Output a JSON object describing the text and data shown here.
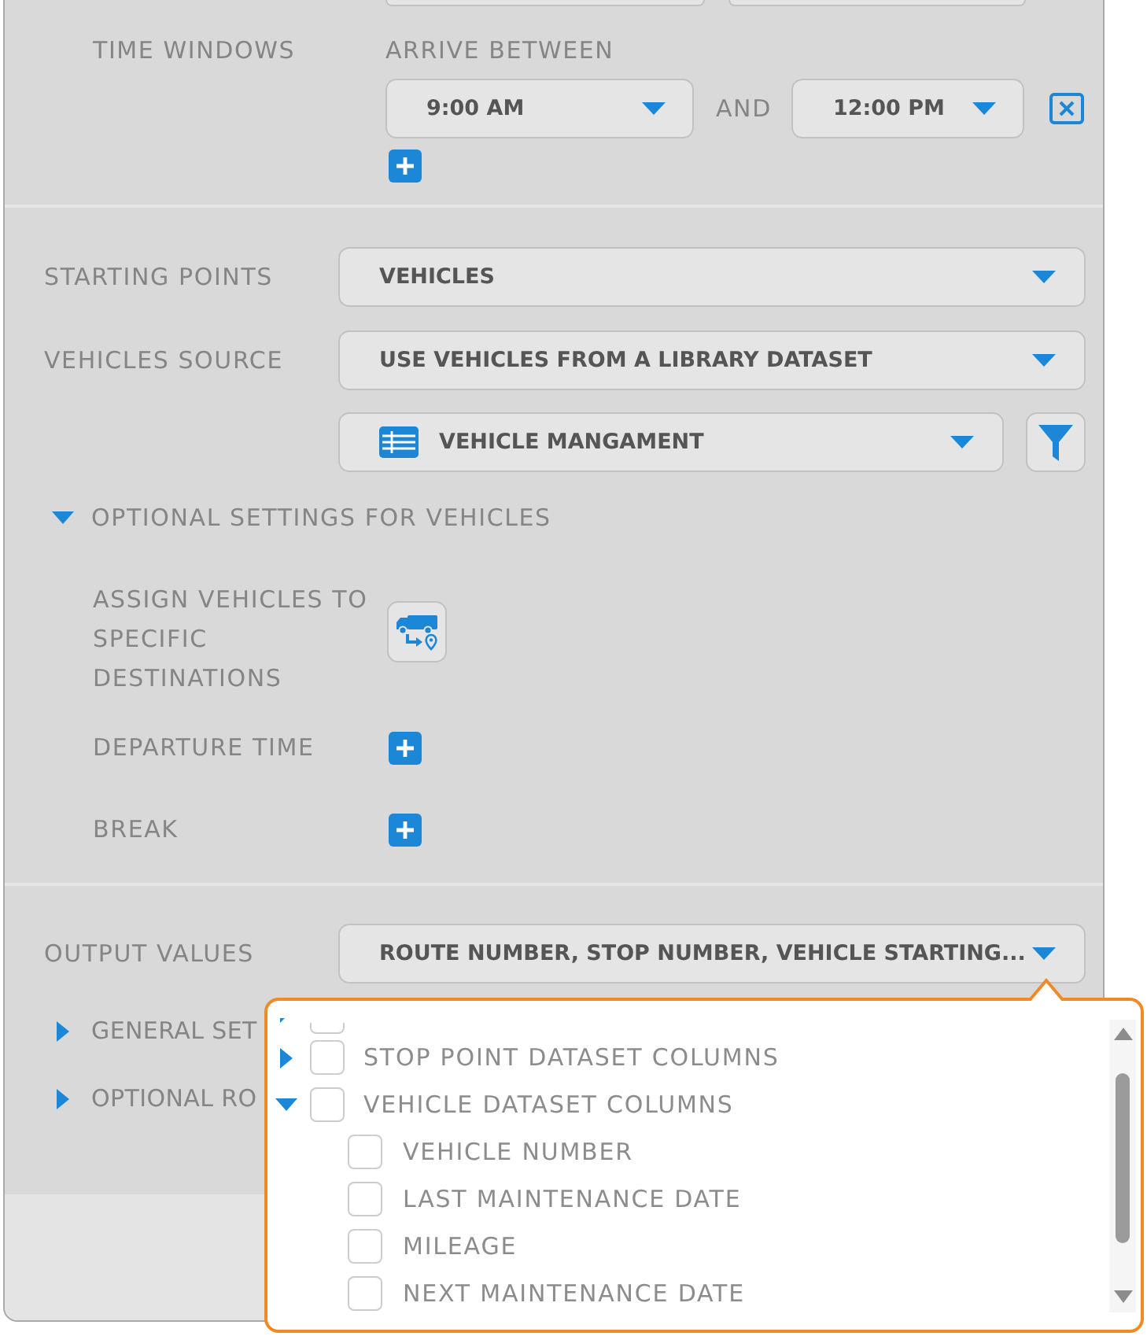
{
  "time_windows": {
    "label": "TIME WINDOWS",
    "heading": "ARRIVE BETWEEN",
    "ranges": [
      {
        "from": "9:00 AM",
        "joiner": "AND",
        "to": "12:00 PM"
      }
    ]
  },
  "vehicles": {
    "fields": [
      {
        "label": "STARTING POINTS",
        "value": "VEHICLES"
      },
      {
        "label": "VEHICLES SOURCE",
        "value": "USE VEHICLES FROM A LIBRARY DATASET"
      }
    ],
    "dataset": {
      "value": "VEHICLE MANGAMENT"
    },
    "optional": {
      "label": "OPTIONAL SETTINGS FOR VEHICLES",
      "expanded": true,
      "items": [
        {
          "label": "ASSIGN VEHICLES TO SPECIFIC DESTINATIONS",
          "kind": "assign"
        },
        {
          "label": "DEPARTURE TIME",
          "kind": "add"
        },
        {
          "label": "BREAK",
          "kind": "add"
        }
      ]
    }
  },
  "output": {
    "label": "OUTPUT VALUES",
    "value": "ROUTE NUMBER, STOP NUMBER, VEHICLE STARTING...",
    "sections": [
      {
        "label": "GENERAL SET",
        "expanded": false
      },
      {
        "label": "OPTIONAL RO",
        "expanded": false
      }
    ]
  },
  "output_menu": {
    "cut_off_item": {
      "checked": false
    },
    "items": [
      {
        "label": "STOP POINT DATASET COLUMNS",
        "expanded": false,
        "checked": false
      },
      {
        "label": "VEHICLE DATASET COLUMNS",
        "expanded": true,
        "checked": false,
        "children": [
          {
            "label": "VEHICLE NUMBER",
            "checked": false
          },
          {
            "label": "LAST MAINTENANCE DATE",
            "checked": false
          },
          {
            "label": "MILEAGE",
            "checked": false
          },
          {
            "label": "NEXT MAINTENANCE DATE",
            "checked": false
          }
        ]
      }
    ]
  }
}
